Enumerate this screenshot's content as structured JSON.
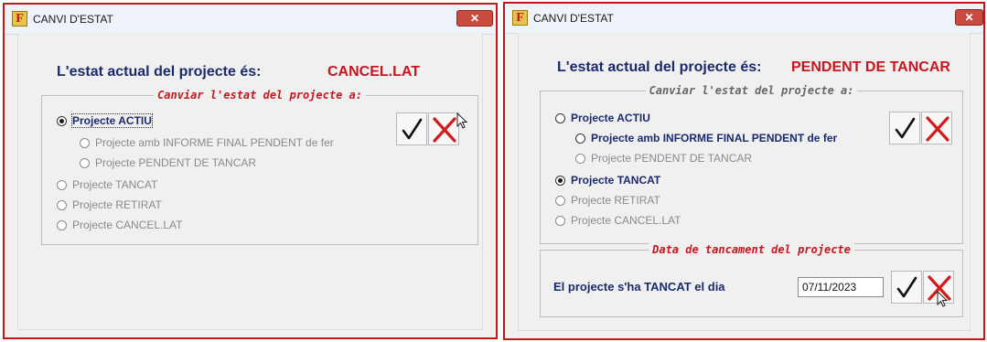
{
  "windows": [
    {
      "title": "CANVI D'ESTAT",
      "close_label": "✕",
      "status_label": "L'estat actual del projecte és:",
      "status_value": "CANCEL.LAT",
      "group_title": "Canviar l'estat del projecte a:",
      "options": [
        {
          "label": "Projecte ACTIU",
          "selected": true,
          "enabled": true
        },
        {
          "label": "Projecte amb INFORME FINAL PENDENT de fer",
          "selected": false,
          "enabled": false
        },
        {
          "label": "Projecte PENDENT DE TANCAR",
          "selected": false,
          "enabled": false
        },
        {
          "label": "Projecte TANCAT",
          "selected": false,
          "enabled": false
        },
        {
          "label": "Projecte RETIRAT",
          "selected": false,
          "enabled": false
        },
        {
          "label": "Projecte CANCEL.LAT",
          "selected": false,
          "enabled": false
        }
      ]
    },
    {
      "title": "CANVI D'ESTAT",
      "close_label": "✕",
      "status_label": "L'estat actual del projecte és:",
      "status_value": "PENDENT DE TANCAR",
      "group_title": "Canviar l'estat del projecte a:",
      "options": [
        {
          "label": "Projecte ACTIU",
          "selected": false,
          "enabled": true
        },
        {
          "label": "Projecte amb INFORME FINAL PENDENT de fer",
          "selected": false,
          "enabled": true
        },
        {
          "label": "Projecte PENDENT DE TANCAR",
          "selected": false,
          "enabled": false
        },
        {
          "label": "Projecte TANCAT",
          "selected": true,
          "enabled": true
        },
        {
          "label": "Projecte RETIRAT",
          "selected": false,
          "enabled": false
        },
        {
          "label": "Projecte CANCEL.LAT",
          "selected": false,
          "enabled": false
        }
      ],
      "date_group_title": "Data de tancament del projecte",
      "date_label": "El projecte s'ha TANCAT el dia",
      "date_value": "07/11/2023"
    }
  ],
  "colors": {
    "accent_red": "#c8161e",
    "label_navy": "#1a2a6c",
    "disabled_gray": "#8a8a8a"
  },
  "icons": {
    "app": "app-f-icon",
    "accept": "checkmark-icon",
    "cancel": "red-x-icon",
    "close": "close-icon"
  }
}
